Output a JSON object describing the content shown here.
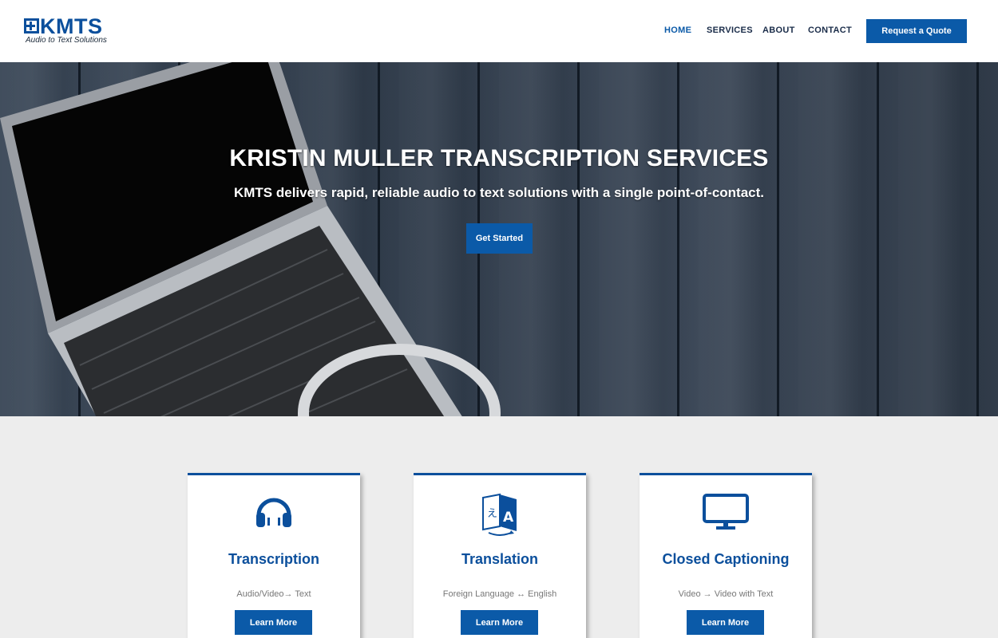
{
  "brand": {
    "name": "KMTS",
    "tagline": "Audio to Text Solutions",
    "accent": "#0b5aa8"
  },
  "nav": {
    "items": [
      "HOME",
      "SERVICES",
      "ABOUT",
      "CONTACT"
    ],
    "active": "HOME",
    "cta_label": "Request a Quote"
  },
  "hero": {
    "title": "KRISTIN MULLER TRANSCRIPTION SERVICES",
    "subtitle": "KMTS delivers rapid, reliable audio to text solutions with a single point-of-contact.",
    "button_label": "Get Started"
  },
  "services": [
    {
      "icon": "headphones-icon",
      "title": "Transcription",
      "description": "Audio/Video→ Text",
      "button_label": "Learn More"
    },
    {
      "icon": "translate-icon",
      "title": "Translation",
      "description": "Foreign Language ↔ English",
      "button_label": "Learn More"
    },
    {
      "icon": "monitor-icon",
      "title": "Closed Captioning",
      "description": "Video → Video with Text",
      "button_label": "Learn More"
    }
  ]
}
